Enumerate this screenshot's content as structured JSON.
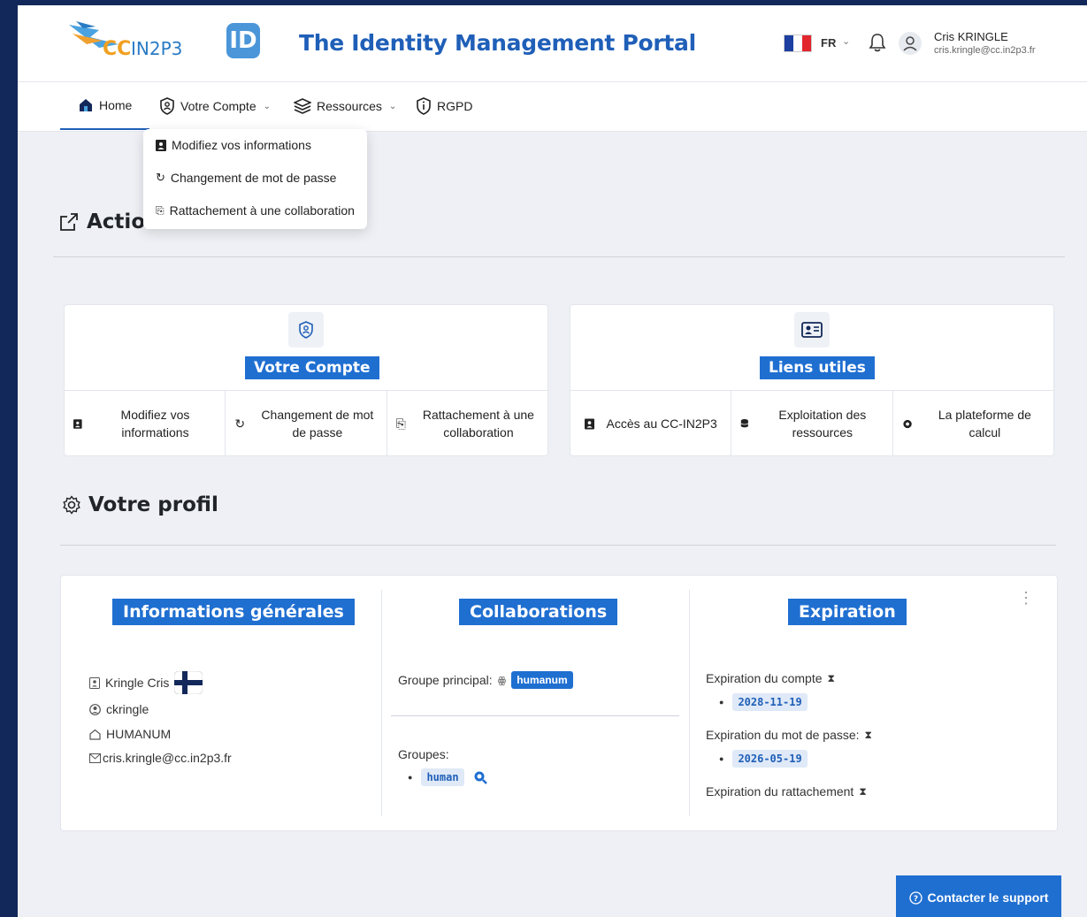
{
  "header": {
    "logo_text": "CCIN2P3",
    "id_badge": "ID",
    "title": "The Identity Management Portal",
    "language": "FR",
    "user_name": "Cris KRINGLE",
    "user_email": "cris.kringle@cc.in2p3.fr"
  },
  "nav": {
    "items": [
      {
        "label": "Home",
        "icon": "home-icon"
      },
      {
        "label": "Votre Compte",
        "icon": "shield-user-icon"
      },
      {
        "label": "Ressources",
        "icon": "layers-icon"
      },
      {
        "label": "RGPD",
        "icon": "shield-info-icon"
      }
    ]
  },
  "dropdown": {
    "items": [
      {
        "label": "Modifiez vos informations",
        "icon": "contact-card-icon"
      },
      {
        "label": "Changement de mot de passe",
        "icon": "refresh-icon"
      },
      {
        "label": "Rattachement à une collaboration",
        "icon": "paperclip-icon"
      }
    ]
  },
  "actions": {
    "title": "Actions",
    "compte_card": {
      "badge": "Votre Compte",
      "cells": [
        "Modifiez vos informations",
        "Changement de mot de passe",
        "Rattachement à une collaboration"
      ]
    },
    "liens_card": {
      "badge": "Liens utiles",
      "cells": [
        "Accès au CC-IN2P3",
        "Exploitation des ressources",
        "La plateforme de calcul"
      ]
    }
  },
  "profile": {
    "title": "Votre profil",
    "general": {
      "badge": "Informations générales",
      "full_name": "Kringle Cris",
      "login": "ckringle",
      "organization": "HUMANUM",
      "email": "cris.kringle@cc.in2p3.fr"
    },
    "collaborations": {
      "badge": "Collaborations",
      "main_group_label": "Groupe principal:",
      "main_group": "humanum",
      "groups_label": "Groupes:",
      "groups": [
        "human"
      ]
    },
    "expiration": {
      "badge": "Expiration",
      "account_label": "Expiration du compte",
      "account_date": "2028-11-19",
      "password_label": "Expiration du mot de passe:",
      "password_date": "2026-05-19",
      "attachment_label": "Expiration du rattachement"
    }
  },
  "support": {
    "label": "Contacter le support"
  },
  "colors": {
    "primary": "#1f6fd1",
    "title_blue": "#1f5fb8",
    "frame": "#13285a"
  }
}
